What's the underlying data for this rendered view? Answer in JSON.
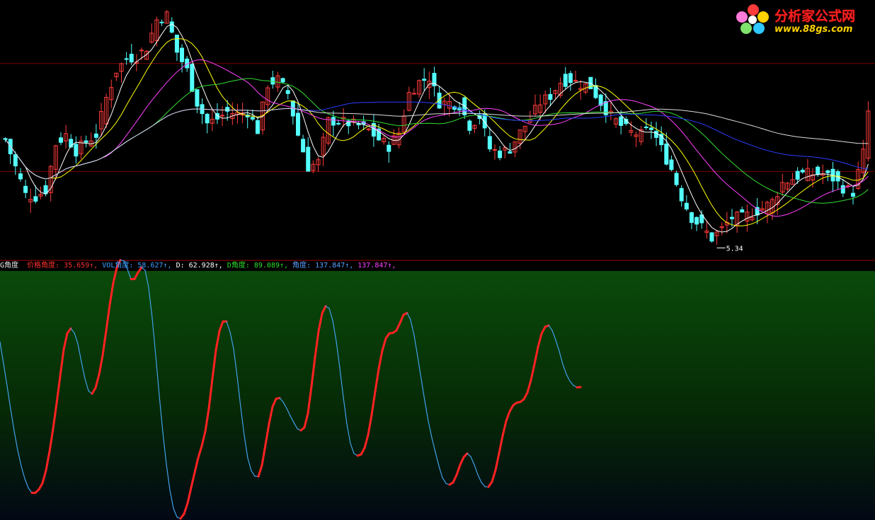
{
  "logo": {
    "title": "分析家公式网",
    "url": "www.88gs.com",
    "colors": [
      "#ff3b3b",
      "#ffd200",
      "#2ec7ff",
      "#7ee26b",
      "#ff7ad9"
    ]
  },
  "indicator_legend": {
    "name": "G角度",
    "items": [
      {
        "label": "价格角度: ",
        "value": "35.659",
        "arrow": "↑",
        "color": "#ff3030"
      },
      {
        "label": "VOL角度: ",
        "value": "58.627",
        "arrow": "↑",
        "color": "#3aa0ff"
      },
      {
        "label": "D: ",
        "value": "62.928",
        "arrow": "↑",
        "color": "#ffffff"
      },
      {
        "label": "D角度: ",
        "value": "89.089",
        "arrow": "↑",
        "color": "#2ee02e"
      },
      {
        "label": "角度: ",
        "value": "137.847",
        "arrow": "↑",
        "color": "#5aa0ff"
      },
      {
        "label": "",
        "value": "137.847",
        "arrow": "↑",
        "color": "#ff40ff"
      }
    ]
  },
  "chart_data": [
    {
      "type": "candlestick",
      "title": "",
      "low_marker": {
        "label": "5.34",
        "value": 5.34,
        "bar": 141
      },
      "colors": {
        "up": "#ff3b3b",
        "down": "#54ffff",
        "ma5": "#ffffff",
        "ma10": "#ffff00",
        "ma20": "#ff40ff",
        "ma30": "#33dd33",
        "ma60": "#2c3cff",
        "ma120": "#dddddd",
        "guide": "#7a0000"
      },
      "ylim": [
        5.1,
        10.7
      ],
      "guides": [
        9.35,
        7.0
      ],
      "close_keypoints": [
        [
          0,
          7.7
        ],
        [
          2,
          7.1
        ],
        [
          4,
          6.5
        ],
        [
          6,
          6.45
        ],
        [
          8,
          6.6
        ],
        [
          10,
          7.6
        ],
        [
          12,
          7.8
        ],
        [
          14,
          7.45
        ],
        [
          16,
          7.65
        ],
        [
          18,
          7.8
        ],
        [
          20,
          8.6
        ],
        [
          22,
          9.2
        ],
        [
          24,
          9.45
        ],
        [
          26,
          9.5
        ],
        [
          28,
          9.7
        ],
        [
          30,
          10.3
        ],
        [
          32,
          10.4
        ],
        [
          34,
          9.6
        ],
        [
          36,
          9.2
        ],
        [
          38,
          8.5
        ],
        [
          40,
          8.05
        ],
        [
          42,
          8.15
        ],
        [
          44,
          8.3
        ],
        [
          46,
          8.25
        ],
        [
          48,
          8.3
        ],
        [
          50,
          7.9
        ],
        [
          52,
          8.9
        ],
        [
          54,
          9.0
        ],
        [
          56,
          8.7
        ],
        [
          58,
          7.8
        ],
        [
          60,
          7.1
        ],
        [
          62,
          7.2
        ],
        [
          64,
          8.1
        ],
        [
          66,
          8.1
        ],
        [
          68,
          8.05
        ],
        [
          70,
          8.0
        ],
        [
          72,
          7.9
        ],
        [
          74,
          7.7
        ],
        [
          76,
          7.55
        ],
        [
          78,
          7.85
        ],
        [
          80,
          8.7
        ],
        [
          82,
          8.95
        ],
        [
          84,
          9.05
        ],
        [
          86,
          8.5
        ],
        [
          88,
          8.5
        ],
        [
          90,
          8.45
        ],
        [
          92,
          8.0
        ],
        [
          94,
          8.2
        ],
        [
          96,
          7.5
        ],
        [
          98,
          7.4
        ],
        [
          100,
          7.5
        ],
        [
          102,
          7.85
        ],
        [
          104,
          8.15
        ],
        [
          106,
          8.5
        ],
        [
          108,
          8.65
        ],
        [
          110,
          8.95
        ],
        [
          112,
          9.0
        ],
        [
          114,
          8.9
        ],
        [
          116,
          8.85
        ],
        [
          118,
          8.5
        ],
        [
          120,
          8.2
        ],
        [
          122,
          8.0
        ],
        [
          124,
          7.85
        ],
        [
          126,
          7.8
        ],
        [
          128,
          7.95
        ],
        [
          130,
          7.5
        ],
        [
          132,
          7.05
        ],
        [
          134,
          6.45
        ],
        [
          136,
          6.0
        ],
        [
          138,
          5.8
        ],
        [
          140,
          5.55
        ],
        [
          142,
          5.75
        ],
        [
          144,
          6.0
        ],
        [
          146,
          6.0
        ],
        [
          148,
          6.1
        ],
        [
          150,
          6.2
        ],
        [
          152,
          6.35
        ],
        [
          154,
          6.75
        ],
        [
          156,
          6.85
        ],
        [
          158,
          6.95
        ],
        [
          160,
          6.95
        ],
        [
          162,
          6.95
        ],
        [
          164,
          6.85
        ],
        [
          166,
          6.65
        ],
        [
          168,
          6.55
        ],
        [
          170,
          7.4
        ],
        [
          171,
          8.3
        ]
      ]
    },
    {
      "type": "line",
      "title": "",
      "series": [
        {
          "name": "价格角度",
          "up_color": "#ff2222",
          "down_color": "#3f9fe8"
        }
      ],
      "ylim": [
        0,
        100
      ],
      "x": [
        0,
        5,
        10,
        15,
        20,
        25,
        30,
        35,
        40,
        45,
        50,
        55,
        60,
        65,
        70,
        75,
        80,
        85,
        90,
        95,
        100,
        105,
        110,
        115,
        120,
        125,
        130,
        135,
        140,
        145,
        150,
        155,
        160,
        165,
        170,
        175,
        180,
        185,
        190,
        195,
        200,
        205,
        210,
        215,
        220,
        225,
        230,
        235,
        240,
        245,
        250,
        255,
        260,
        265,
        270,
        275,
        280,
        285,
        290,
        295,
        300,
        305,
        310,
        315,
        320,
        325,
        330,
        335,
        340,
        345,
        350,
        355,
        360,
        365,
        370,
        375,
        380,
        385,
        390,
        395,
        400,
        405,
        410,
        415,
        420,
        425,
        430,
        435,
        440,
        445,
        450,
        455,
        460,
        465,
        470,
        475,
        480,
        485,
        490,
        495,
        500,
        505,
        510,
        515,
        520,
        525,
        530,
        535,
        540,
        545,
        550,
        555,
        560,
        565,
        570,
        575,
        580,
        585,
        590,
        595,
        600,
        605,
        610,
        615,
        620,
        625,
        630,
        635,
        640,
        645,
        650,
        655,
        660,
        665,
        670,
        675,
        680,
        685,
        690,
        695,
        700,
        705,
        710,
        715,
        720,
        725,
        730,
        735,
        740,
        745,
        750,
        755,
        760,
        765,
        770,
        775,
        780,
        785,
        790,
        795,
        800,
        805,
        810,
        815,
        820,
        825,
        830,
        835,
        840,
        845,
        850,
        855,
        860,
        865,
        870,
        875,
        880,
        885,
        890,
        895,
        900,
        905,
        910,
        915,
        920,
        925,
        930,
        935,
        940,
        945,
        950,
        955,
        960,
        965,
        970,
        975,
        980,
        985,
        990,
        995,
        1000,
        1005,
        1010,
        1015,
        1020,
        1025,
        1030,
        1035,
        1040,
        1045,
        1050,
        1055,
        1060,
        1065,
        1070,
        1075,
        1080,
        1085,
        1090,
        1095,
        1100,
        1105,
        1110,
        1115,
        1120,
        1125,
        1130,
        1135,
        1140,
        1145,
        1150,
        1155,
        1160,
        1165,
        1170,
        1175,
        1180,
        1185,
        1190,
        1195,
        1200,
        1205,
        1210,
        1215,
        1220,
        1225,
        1230
      ],
      "values": [
        71.4,
        62.6,
        53.6,
        44.3,
        35.4,
        27.6,
        21.2,
        16.1,
        12.4,
        10.4,
        10.4,
        11.8,
        14.3,
        19.5,
        27.1,
        36.3,
        46.6,
        57.5,
        68.3,
        74.8,
        76.8,
        75.0,
        70.6,
        63.3,
        56.5,
        51.6,
        50.4,
        52.8,
        58.2,
        65.9,
        75.9,
        86.3,
        95.2,
        101.3,
        104.4,
        104.1,
        100.7,
        96.7,
        96.7,
        99.4,
        101.4,
        100.3,
        93.2,
        81.0,
        65.7,
        49.7,
        34.8,
        22.0,
        11.5,
        4.1,
        0.6,
        0.0,
        1.9,
        6.2,
        12.5,
        18.6,
        24.6,
        29.3,
        35.2,
        44.4,
        56.5,
        68.0,
        75.8,
        79.6,
        79.6,
        75.4,
        68.5,
        57.5,
        44.9,
        33.6,
        24.4,
        19.3,
        17.1,
        17.0,
        21.5,
        29.8,
        38.2,
        45.2,
        48.4,
        48.7,
        47.1,
        44.5,
        41.5,
        38.8,
        36.3,
        35.6,
        36.8,
        42.5,
        53.4,
        65.2,
        75.7,
        82.8,
        85.8,
        84.9,
        80.0,
        71.6,
        60.8,
        49.0,
        38.1,
        30.3,
        26.3,
        25.4,
        25.9,
        28.5,
        33.8,
        41.9,
        51.4,
        60.5,
        67.8,
        72.8,
        74.8,
        75.0,
        76.0,
        79.0,
        82.3,
        83.0,
        80.3,
        73.9,
        65.4,
        56.4,
        47.5,
        39.4,
        32.6,
        26.8,
        21.2,
        16.5,
        14.2,
        13.7,
        14.6,
        17.6,
        21.7,
        24.8,
        26.3,
        25.0,
        21.7,
        17.7,
        14.6,
        12.9,
        12.8,
        14.9,
        19.6,
        26.4,
        33.4,
        39.4,
        43.3,
        45.8,
        46.8,
        47.1,
        48.2,
        50.9,
        55.9,
        62.4,
        69.3,
        74.7,
        77.4,
        78.0,
        76.0,
        72.1,
        67.6,
        62.3,
        58.3,
        55.5,
        53.8,
        53.0,
        53.1
      ]
    }
  ]
}
